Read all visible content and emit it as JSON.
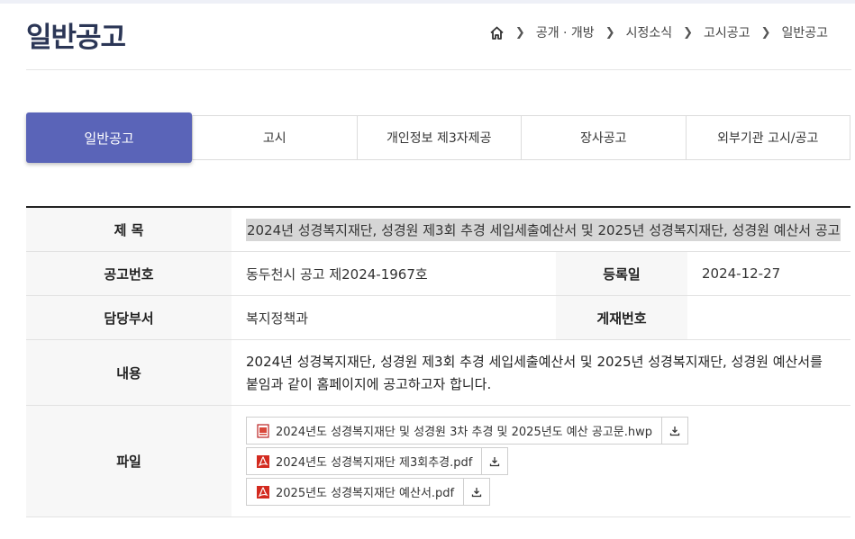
{
  "header": {
    "title": "일반공고",
    "breadcrumb": [
      "공개 · 개방",
      "시정소식",
      "고시공고",
      "일반공고"
    ]
  },
  "tabs": {
    "active": "일반공고",
    "items": [
      "고시",
      "개인정보 제3자제공",
      "장사공고",
      "외부기관 고시/공고"
    ]
  },
  "detail": {
    "title_label": "제 목",
    "title_value": "2024년 성경복지재단, 성경원 제3회 추경 세입세출예산서 및 2025년 성경복지재단, 성경원 예산서 공고",
    "notice_no_label": "공고번호",
    "notice_no_value": "동두천시 공고 제2024-1967호",
    "reg_date_label": "등록일",
    "reg_date_value": "2024-12-27",
    "dept_label": "담당부서",
    "dept_value": "복지정책과",
    "post_no_label": "게재번호",
    "post_no_value": "",
    "content_label": "내용",
    "content_value": "2024년 성경복지재단, 성경원 제3회 추경 세입세출예산서 및 2025년  성경복지재단, 성경원 예산서를 붙임과 같이 홈페이지에 공고하고자 합니다.",
    "files_label": "파일",
    "files": [
      {
        "name": "2024년도 성경복지재단 및 성경원 3차 추경 및 2025년도 예산 공고문.hwp",
        "icon": "hwp-file-icon"
      },
      {
        "name": "2024년도 성경복지재단 제3회추경.pdf",
        "icon": "pdf-file-icon"
      },
      {
        "name": "2025년도 성경복지재단 예산서.pdf",
        "icon": "pdf-file-icon"
      }
    ]
  },
  "colors": {
    "accent": "#5a64b8",
    "title": "#2b3656",
    "pdf_red": "#d32a1f"
  }
}
